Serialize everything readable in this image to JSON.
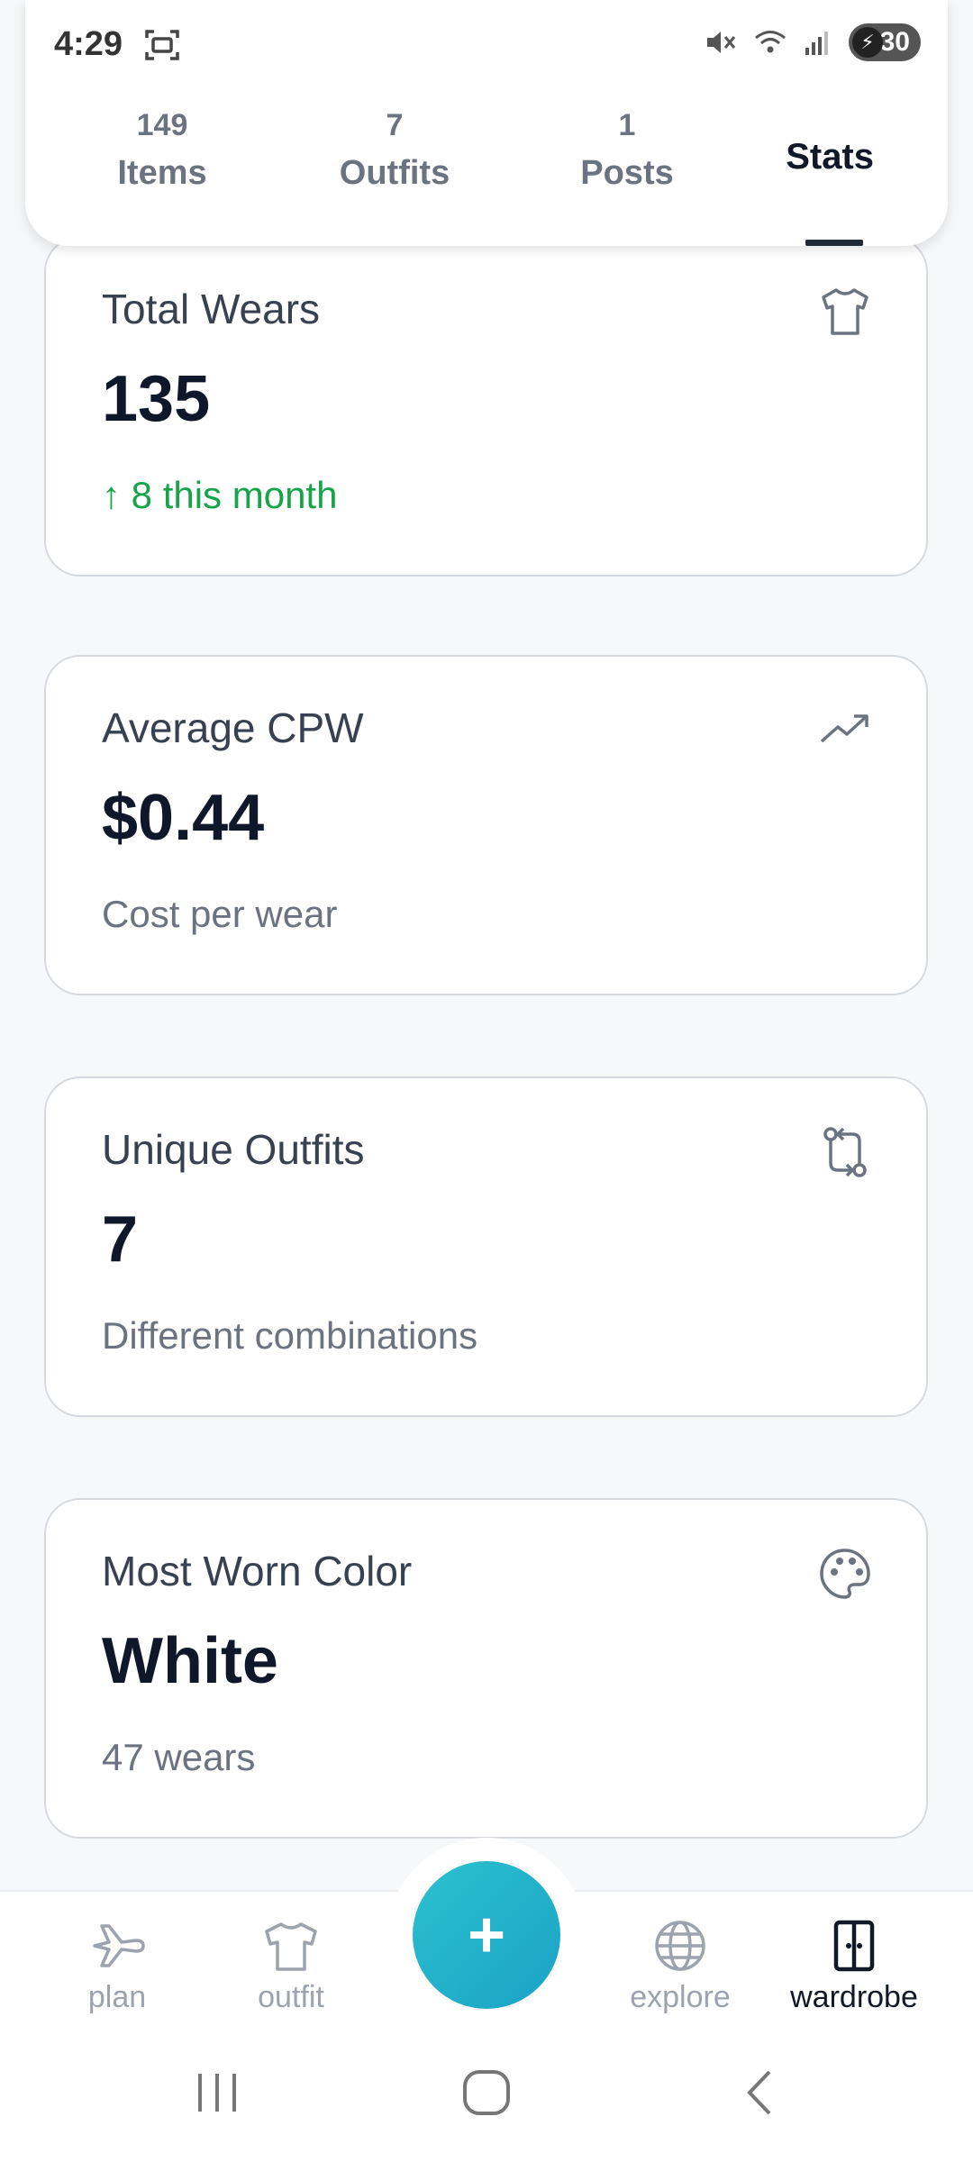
{
  "status_bar": {
    "time": "4:29",
    "battery_level": "30"
  },
  "tabs": [
    {
      "count": "149",
      "label": "Items"
    },
    {
      "count": "7",
      "label": "Outfits"
    },
    {
      "count": "1",
      "label": "Posts"
    },
    {
      "label": "Stats",
      "active": true
    }
  ],
  "cards": [
    {
      "title": "Total Wears",
      "value": "135",
      "sub": "↑ 8 this month",
      "icon": "shirt-icon"
    },
    {
      "title": "Average CPW",
      "value": "$0.44",
      "sub": "Cost per wear",
      "icon": "trending-up-icon"
    },
    {
      "title": "Unique Outfits",
      "value": "7",
      "sub": "Different combinations",
      "icon": "swap-icon"
    },
    {
      "title": "Most Worn Color",
      "value": "White",
      "sub": "47 wears",
      "icon": "palette-icon"
    }
  ],
  "bottom_nav": {
    "items": [
      {
        "label": "plan",
        "icon": "plane-icon"
      },
      {
        "label": "outfit",
        "icon": "shirt-icon"
      },
      {
        "label": "explore",
        "icon": "globe-icon"
      },
      {
        "label": "wardrobe",
        "icon": "wardrobe-icon",
        "active": true
      }
    ],
    "fab_label": "+"
  },
  "colors": {
    "accent": "#1aa3c6",
    "positive": "#16a34a",
    "text_primary": "#0f172a",
    "text_secondary": "#6b7280"
  }
}
